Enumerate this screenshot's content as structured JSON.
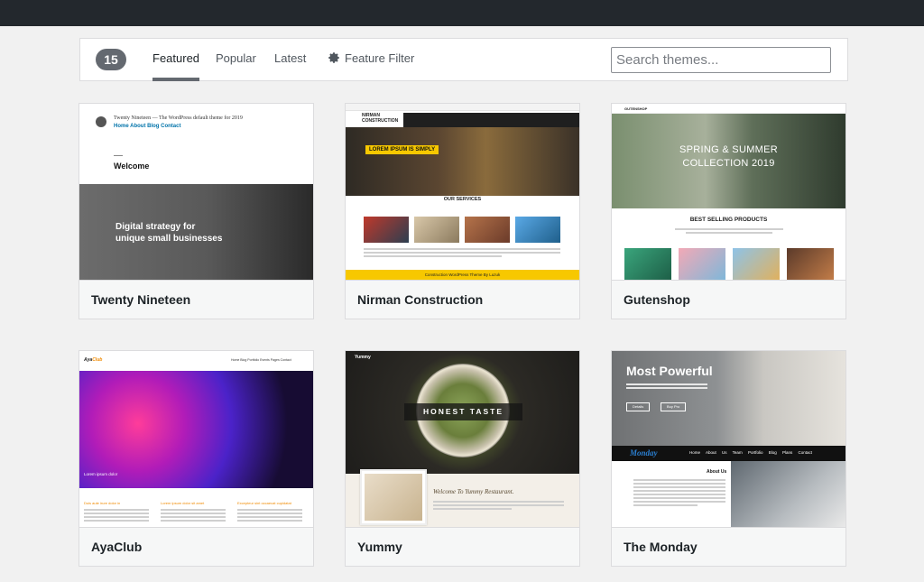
{
  "filter_bar": {
    "theme_count": "15",
    "tabs": [
      {
        "label": "Featured"
      },
      {
        "label": "Popular"
      },
      {
        "label": "Latest"
      }
    ],
    "feature_filter_label": "Feature Filter",
    "search_placeholder": "Search themes..."
  },
  "themes": [
    {
      "name": "Twenty Nineteen",
      "preview": {
        "site_title": "Twenty Nineteen — The WordPress default theme for 2019",
        "nav": "Home  About  Blog  Contact",
        "welcome": "Welcome",
        "hero_text": "Digital strategy for\nunique small businesses"
      }
    },
    {
      "name": "Nirman Construction",
      "preview": {
        "logo": "NIRMAN CONSTRUCTION",
        "badge": "LOREM IPSUM IS SIMPLY",
        "services_heading": "OUR SERVICES",
        "footer": "Construction WordPress Theme By Luzuk"
      }
    },
    {
      "name": "Gutenshop",
      "preview": {
        "logo": "GUTENSHOP",
        "hero_text": "SPRING & SUMMER\nCOLLECTION 2019",
        "section_title": "BEST SELLING PRODUCTS"
      }
    },
    {
      "name": "AyaClub",
      "preview": {
        "logo_prefix": "Aya",
        "logo_suffix": "Club",
        "nav": "Home  Blog  Portfolio  Events  Pages  Contact",
        "caption": "Lorem ipsum dolor",
        "columns": [
          "Duis aute irure dolor in",
          "Lorem ipsum dolor sit amet",
          "Excepteur sint occaecat cupidatat"
        ]
      }
    },
    {
      "name": "Yummy",
      "preview": {
        "logo": "Yummy",
        "badge": "HONEST TASTE",
        "welcome": "Welcome To Yummy Restaurant."
      }
    },
    {
      "name": "The Monday",
      "preview": {
        "hero_title": "Most Powerful",
        "btn_details": "Details",
        "btn_buy": "Buy Pro",
        "logo": "Monday",
        "nav": "Home About Us Team Portfolio Blog Plans Contact",
        "about_heading": "About Us"
      }
    }
  ],
  "colors": {
    "topbar": "#23282d",
    "count_badge": "#646970",
    "nirman_yellow": "#f7c800",
    "ayaclub_orange": "#f08a00",
    "monday_blue": "#2a7fd1"
  }
}
